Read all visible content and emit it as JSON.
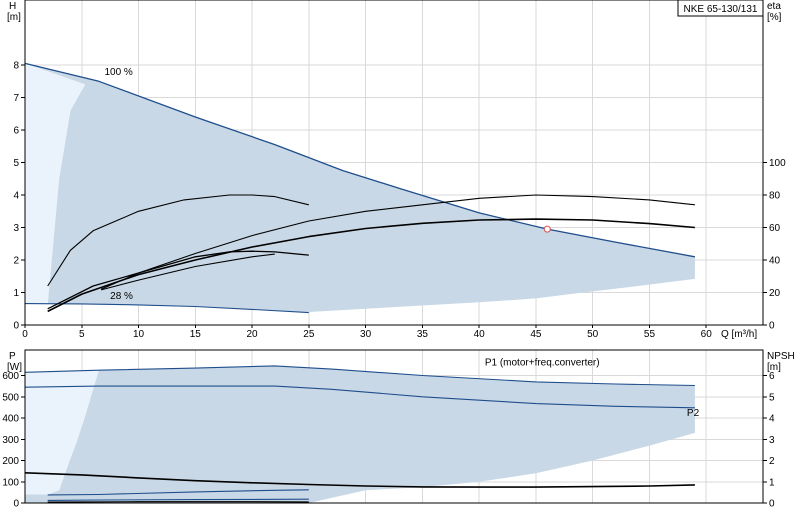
{
  "title_box": "NKE 65-130/131",
  "colors": {
    "envelope_fill": "#c9d8e6",
    "envelope_light": "#eaf3fc",
    "curve_blue": "#1f4e8c",
    "curve_black": "#000000",
    "marker": "#e05050"
  },
  "chart_data": [
    {
      "type": "line",
      "name": "top",
      "x_unit_label": "Q [m³/h]",
      "left_axis_label": [
        "H",
        "[m]"
      ],
      "right_axis_label": [
        "eta",
        "[%]"
      ],
      "x_ticks": [
        "0",
        "5",
        "10",
        "15",
        "20",
        "25",
        "30",
        "35",
        "40",
        "45",
        "50",
        "55",
        "60"
      ],
      "y_ticks": [
        "0",
        "1",
        "2",
        "3",
        "4",
        "5",
        "6",
        "7",
        "8"
      ],
      "right_ticks": [
        "0",
        "20",
        "40",
        "60",
        "80",
        "100"
      ],
      "xlim": [
        0,
        65
      ],
      "ylim": [
        0,
        10
      ],
      "right_lim": [
        0,
        200
      ],
      "annotations": [
        {
          "text": "100 %",
          "x": 7.0,
          "y": 7.7
        },
        {
          "text": "28 %",
          "x": 7.5,
          "y": 0.8
        }
      ],
      "operating_point": {
        "x": 46,
        "y": 2.95
      },
      "envelope": [
        [
          0,
          8.05
        ],
        [
          6.5,
          7.5
        ],
        [
          15,
          6.4
        ],
        [
          22,
          5.55
        ],
        [
          28,
          4.75
        ],
        [
          33,
          4.2
        ],
        [
          40,
          3.45
        ],
        [
          46,
          2.95
        ],
        [
          52,
          2.55
        ],
        [
          59,
          2.1
        ],
        [
          59,
          1.42
        ],
        [
          54,
          1.2
        ],
        [
          48,
          0.95
        ],
        [
          45,
          0.82
        ],
        [
          40,
          0.7
        ],
        [
          35,
          0.6
        ],
        [
          30,
          0.5
        ],
        [
          25,
          0.4
        ],
        [
          20,
          0.48
        ],
        [
          15,
          0.57
        ],
        [
          10,
          0.62
        ],
        [
          5,
          0.65
        ],
        [
          2,
          0.66
        ],
        [
          3,
          4.5
        ],
        [
          4,
          6.6
        ],
        [
          5.3,
          7.4
        ]
      ],
      "light_region": [
        [
          0,
          8.05
        ],
        [
          5.3,
          7.4
        ],
        [
          4,
          6.6
        ],
        [
          3,
          4.5
        ],
        [
          2,
          0.66
        ],
        [
          0,
          0.66
        ]
      ],
      "series": [
        {
          "axis": "left",
          "color": "blue",
          "width": 1.3,
          "points": [
            [
              0,
              8.05
            ],
            [
              6.5,
              7.5
            ],
            [
              15,
              6.4
            ],
            [
              22,
              5.55
            ],
            [
              28,
              4.75
            ],
            [
              33,
              4.2
            ],
            [
              40,
              3.45
            ],
            [
              46,
              2.95
            ],
            [
              52,
              2.55
            ],
            [
              59,
              2.1
            ]
          ]
        },
        {
          "axis": "left",
          "color": "blue",
          "width": 1.1,
          "points": [
            [
              0,
              0.66
            ],
            [
              5,
              0.65
            ],
            [
              10,
              0.62
            ],
            [
              15,
              0.57
            ],
            [
              20,
              0.48
            ],
            [
              25,
              0.38
            ]
          ]
        },
        {
          "axis": "left",
          "color": "black",
          "width": 1.6,
          "points": [
            [
              2,
              0.42
            ],
            [
              5,
              0.95
            ],
            [
              10,
              1.55
            ],
            [
              15,
              2.0
            ],
            [
              20,
              2.4
            ],
            [
              25,
              2.72
            ],
            [
              30,
              2.97
            ],
            [
              35,
              3.13
            ],
            [
              40,
              3.23
            ],
            [
              45,
              3.26
            ],
            [
              50,
              3.23
            ],
            [
              55,
              3.12
            ],
            [
              59,
              3.0
            ]
          ]
        },
        {
          "axis": "left",
          "color": "black",
          "width": 1.3,
          "points": [
            [
              2,
              0.5
            ],
            [
              6,
              1.2
            ],
            [
              10,
              1.6
            ],
            [
              15,
              2.1
            ],
            [
              18,
              2.25
            ],
            [
              20,
              2.27
            ],
            [
              22,
              2.25
            ],
            [
              25,
              2.15
            ]
          ]
        },
        {
          "axis": "left",
          "color": "black",
          "width": 1.1,
          "points": [
            [
              6.7,
              1.08
            ],
            [
              10,
              1.38
            ],
            [
              15,
              1.8
            ],
            [
              20,
              2.1
            ],
            [
              22,
              2.18
            ]
          ]
        },
        {
          "axis": "right",
          "color": "black",
          "width": 1.1,
          "points": [
            [
              2,
              24
            ],
            [
              4,
              46
            ],
            [
              6,
              58
            ],
            [
              8,
              64
            ],
            [
              10,
              70
            ],
            [
              14,
              77
            ],
            [
              18,
              80
            ],
            [
              20,
              80
            ],
            [
              22,
              79
            ],
            [
              25,
              74
            ]
          ]
        },
        {
          "axis": "right",
          "color": "black",
          "width": 1.1,
          "points": [
            [
              6.7,
              22
            ],
            [
              10,
              32
            ],
            [
              15,
              44
            ],
            [
              20,
              55
            ],
            [
              25,
              64
            ],
            [
              30,
              70
            ],
            [
              35,
              74
            ],
            [
              40,
              78
            ],
            [
              45,
              80
            ],
            [
              50,
              79
            ],
            [
              55,
              77
            ],
            [
              59,
              74
            ]
          ]
        }
      ]
    },
    {
      "type": "line",
      "name": "bottom",
      "left_axis_label": [
        "P",
        "[W]"
      ],
      "right_axis_label": [
        "NPSH",
        "[m]"
      ],
      "y_ticks": [
        "0",
        "100",
        "200",
        "300",
        "400",
        "500",
        "600"
      ],
      "right_ticks": [
        "0",
        "1",
        "2",
        "3",
        "4",
        "5",
        "6"
      ],
      "xlim": [
        0,
        65
      ],
      "ylim": [
        0,
        720
      ],
      "right_lim": [
        0,
        7.2
      ],
      "annotations": [
        {
          "text": "P1 (motor+freq.converter)",
          "x": 40.5,
          "y": 648,
          "anchor": "start",
          "color": "blue"
        },
        {
          "text": "P2",
          "x": 58.3,
          "y": 410,
          "anchor": "start",
          "color": "blue"
        }
      ],
      "envelope": [
        [
          0,
          615
        ],
        [
          6.5,
          625
        ],
        [
          15,
          635
        ],
        [
          22,
          645
        ],
        [
          27,
          630
        ],
        [
          35,
          600
        ],
        [
          45,
          570
        ],
        [
          52,
          560
        ],
        [
          59,
          553
        ],
        [
          59,
          330
        ],
        [
          55,
          270
        ],
        [
          50,
          200
        ],
        [
          45,
          140
        ],
        [
          40,
          100
        ],
        [
          35,
          75
        ],
        [
          30,
          60
        ],
        [
          25,
          0
        ],
        [
          0,
          0
        ],
        [
          0,
          40
        ],
        [
          2,
          40
        ],
        [
          3,
          60
        ],
        [
          3.8,
          180
        ],
        [
          4.5,
          280
        ],
        [
          5.3,
          410
        ],
        [
          6.5,
          625
        ]
      ],
      "light_region": [
        [
          0,
          615
        ],
        [
          6.5,
          625
        ],
        [
          5.3,
          410
        ],
        [
          4.5,
          280
        ],
        [
          3.8,
          180
        ],
        [
          3,
          60
        ],
        [
          2,
          40
        ],
        [
          0,
          40
        ]
      ],
      "series": [
        {
          "axis": "left",
          "color": "blue",
          "width": 1.1,
          "points": [
            [
              0,
              615
            ],
            [
              6.5,
              625
            ],
            [
              15,
              635
            ],
            [
              22,
              645
            ],
            [
              27,
              630
            ],
            [
              35,
              600
            ],
            [
              45,
              570
            ],
            [
              52,
              560
            ],
            [
              59,
              553
            ]
          ]
        },
        {
          "axis": "left",
          "color": "blue",
          "width": 1.1,
          "points": [
            [
              0,
              545
            ],
            [
              6.5,
              550
            ],
            [
              15,
              550
            ],
            [
              22,
              550
            ],
            [
              27,
              535
            ],
            [
              35,
              500
            ],
            [
              45,
              468
            ],
            [
              52,
              455
            ],
            [
              59,
              448
            ]
          ]
        },
        {
          "axis": "left",
          "color": "blue",
          "width": 1.1,
          "points": [
            [
              2,
              38
            ],
            [
              6.5,
              40
            ],
            [
              15,
              52
            ],
            [
              22,
              60
            ],
            [
              25,
              62
            ]
          ]
        },
        {
          "axis": "left",
          "color": "blue",
          "width": 1.1,
          "points": [
            [
              2,
              12
            ],
            [
              6.5,
              14
            ],
            [
              15,
              16
            ],
            [
              25,
              18
            ]
          ]
        },
        {
          "axis": "right",
          "color": "black",
          "width": 1.6,
          "points": [
            [
              0,
              1.42
            ],
            [
              5,
              1.32
            ],
            [
              10,
              1.18
            ],
            [
              15,
              1.05
            ],
            [
              20,
              0.95
            ],
            [
              25,
              0.87
            ],
            [
              30,
              0.8
            ],
            [
              35,
              0.76
            ],
            [
              40,
              0.75
            ],
            [
              45,
              0.75
            ],
            [
              50,
              0.77
            ],
            [
              55,
              0.8
            ],
            [
              59,
              0.85
            ]
          ]
        },
        {
          "axis": "right",
          "color": "black",
          "width": 1.1,
          "points": [
            [
              2,
              0.04
            ],
            [
              10,
              0.06
            ],
            [
              20,
              0.06
            ],
            [
              25,
              0.05
            ]
          ]
        }
      ]
    }
  ]
}
